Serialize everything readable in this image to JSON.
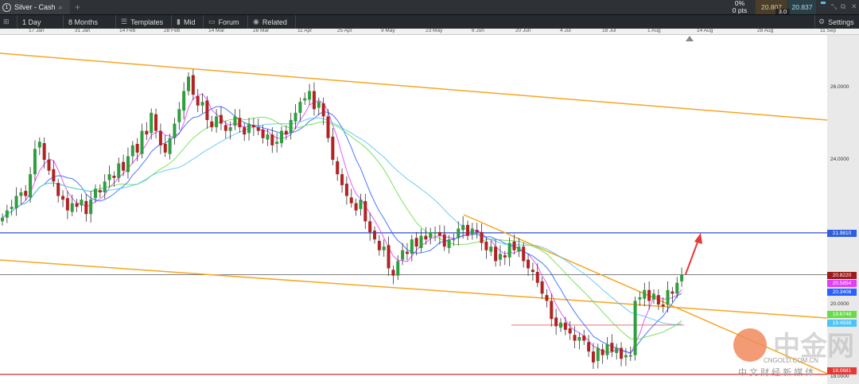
{
  "window": {
    "tab_number": "1",
    "title": "Silver - Cash",
    "change_pct": "0%",
    "change_pts": "0 pts",
    "bid": "20.807",
    "ask": "20.837",
    "spread": "3.0"
  },
  "toolbar": {
    "interval": "1 Day",
    "range": "8 Months",
    "templates": "Templates",
    "mid": "Mid",
    "forum": "Forum",
    "related": "Related",
    "settings": "Settings"
  },
  "date_axis": [
    "17 Jan",
    "31 Jan",
    "14 Feb",
    "28 Feb",
    "14 Mar",
    "28 Mar",
    "11 Apr",
    "25 Apr",
    "9 May",
    "23 May",
    "6 Jun",
    "20 Jun",
    "4 Jul",
    "18 Jul",
    "1 Aug",
    "14 Aug",
    "28 Aug",
    "11 Sep"
  ],
  "price_axis": [
    "26.0000",
    "24.0000",
    "20.0000",
    "18.0000"
  ],
  "price_tags": [
    {
      "label": "21.9810",
      "color": "#2f5fe0"
    },
    {
      "label": "20.8220",
      "color": "#9b1c1c"
    },
    {
      "label": "20.5854",
      "color": "#e040fb"
    },
    {
      "label": "20.3408",
      "color": "#2962ff"
    },
    {
      "label": "19.6748",
      "color": "#66dd44"
    },
    {
      "label": "19.4938",
      "color": "#4fc3f7"
    },
    {
      "label": "18.0681",
      "color": "#e53935"
    }
  ],
  "watermark": {
    "brand": "中金网",
    "domain": "CNGOLD.COM.CN",
    "slogan": "中 文 财 经 新 媒 体"
  },
  "chart_data": {
    "type": "candlestick",
    "instrument": "Silver - Cash",
    "interval": "1 Day",
    "ylim": [
      17.8,
      27.2
    ],
    "colors": {
      "up": "#2e9e3e",
      "down": "#b22222",
      "ma_fast": "#e040fb",
      "ma_mid": "#2962ff",
      "ma_slow": "#66dd44",
      "ma_slowest": "#4fc3f7",
      "trendline": "#f5a623"
    },
    "closes": [
      22.4,
      22.6,
      22.7,
      23.0,
      23.1,
      23.0,
      23.6,
      24.3,
      24.5,
      24.0,
      23.7,
      23.4,
      23.0,
      22.9,
      22.6,
      22.8,
      22.7,
      22.9,
      22.5,
      22.9,
      23.2,
      23.1,
      23.4,
      23.6,
      23.5,
      23.9,
      23.7,
      24.1,
      24.4,
      24.2,
      24.8,
      24.7,
      25.3,
      24.8,
      24.4,
      24.2,
      24.6,
      25.0,
      25.4,
      25.9,
      26.3,
      25.8,
      25.5,
      25.6,
      25.1,
      24.9,
      25.2,
      25.0,
      24.8,
      24.9,
      25.2,
      24.9,
      24.7,
      25.0,
      24.9,
      24.8,
      24.6,
      24.7,
      24.4,
      24.5,
      24.8,
      24.7,
      25.1,
      25.3,
      25.6,
      25.7,
      25.9,
      25.4,
      25.6,
      25.2,
      24.6,
      24.0,
      23.6,
      23.3,
      23.0,
      22.8,
      22.6,
      22.9,
      22.3,
      22.0,
      21.8,
      21.5,
      21.6,
      21.0,
      20.8,
      21.2,
      21.5,
      21.4,
      21.8,
      21.6,
      21.9,
      21.8,
      22.0,
      22.0,
      21.9,
      21.6,
      21.8,
      21.8,
      22.1,
      22.2,
      21.9,
      22.1,
      22.0,
      21.7,
      21.5,
      21.6,
      21.2,
      21.4,
      21.3,
      21.7,
      21.5,
      21.6,
      21.2,
      21.0,
      20.9,
      20.6,
      20.3,
      20.1,
      19.6,
      19.4,
      19.5,
      19.3,
      19.2,
      19.0,
      19.1,
      19.0,
      18.7,
      18.4,
      18.8,
      18.6,
      18.9,
      18.7,
      18.8,
      18.5,
      18.6,
      18.6,
      20.1,
      20.2,
      20.4,
      20.1,
      20.3,
      20.0,
      19.95,
      20.4,
      20.3,
      20.6,
      20.82
    ],
    "horizontal_levels": [
      21.981,
      20.822,
      19.43,
      18.068
    ]
  }
}
